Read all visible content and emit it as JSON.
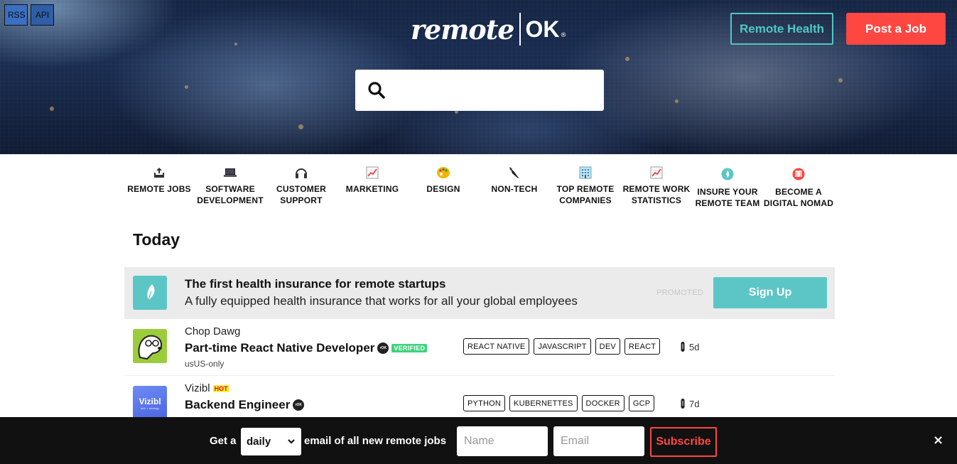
{
  "header": {
    "top_links": [
      "RSS",
      "API"
    ],
    "logo_word": "remote",
    "logo_ok": "OK",
    "logo_reg": "®",
    "remote_health_label": "Remote Health",
    "post_job_label": "Post a Job",
    "search_placeholder": ""
  },
  "nav": {
    "items": [
      {
        "label": "REMOTE JOBS",
        "icon": "outbox-tray-icon"
      },
      {
        "label": "SOFTWARE DEVELOPMENT",
        "icon": "laptop-icon"
      },
      {
        "label": "CUSTOMER SUPPORT",
        "icon": "headphones-icon"
      },
      {
        "label": "MARKETING",
        "icon": "chart-up-icon"
      },
      {
        "label": "DESIGN",
        "icon": "palette-icon"
      },
      {
        "label": "NON-TECH",
        "icon": "pen-icon"
      },
      {
        "label": "TOP REMOTE COMPANIES",
        "icon": "office-building-icon"
      },
      {
        "label": "REMOTE WORK STATISTICS",
        "icon": "chart-up-icon"
      },
      {
        "label": "INSURE YOUR REMOTE TEAM",
        "icon": "safetywing-logo-icon"
      },
      {
        "label": "BECOME A DIGITAL NOMAD",
        "icon": "nomad-logo-icon"
      }
    ]
  },
  "section_title": "Today",
  "promo": {
    "title": "The first health insurance for remote startups",
    "subtitle": "A fully equipped health insurance that works for all your global employees",
    "promoted_label": "PROMOTED",
    "signup_label": "Sign Up"
  },
  "jobs": [
    {
      "company": "Chop Dawg",
      "position": "Part-time React Native Developer",
      "verified_label": "VERIFIED",
      "location": "usUS-only",
      "tags": [
        "REACT NATIVE",
        "JAVASCRIPT",
        "DEV",
        "REACT"
      ],
      "age": "5d"
    },
    {
      "company": "Vizibl",
      "hot_label": "HOT",
      "position": "Backend Engineer",
      "tags": [
        "PYTHON",
        "KUBERNETTES",
        "DOCKER",
        "GCP"
      ],
      "age": "7d",
      "logo_text": "Vizibl",
      "logo_subtext": "tech + strategy"
    }
  ],
  "subscribe_bar": {
    "prefix": "Get a",
    "frequency": "daily",
    "suffix": "email of all new remote jobs",
    "name_placeholder": "Name",
    "email_placeholder": "Email",
    "subscribe_label": "Subscribe",
    "close_label": "×"
  },
  "colors": {
    "accent_red": "#ff4742",
    "accent_teal": "#5cc6c6",
    "verified_green": "#3cd37a"
  }
}
